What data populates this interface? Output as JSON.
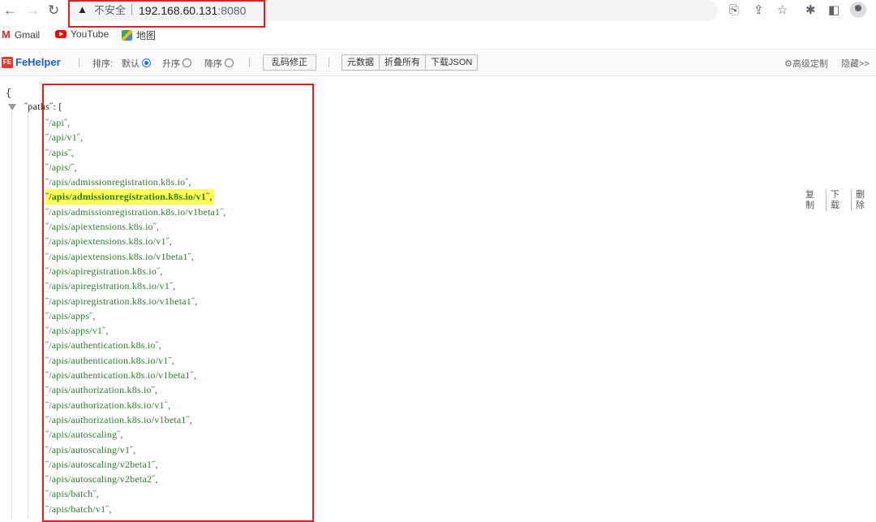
{
  "browser": {
    "warning_label": "不安全",
    "url_host": "192.168.60.131",
    "url_port": ":8080"
  },
  "bookmarks": [
    {
      "label": "Gmail"
    },
    {
      "label": "YouTube"
    },
    {
      "label": "地图"
    }
  ],
  "fehelper": {
    "logo": "FeHelper",
    "sort_label": "排序:",
    "sort_default": "默认",
    "sort_asc": "升序",
    "sort_desc": "降序",
    "fix_encoding": "乱码修正",
    "raw_data": "元数据",
    "collapse_all": "折叠所有",
    "download_json": "下载JSON",
    "advanced": "高级定制",
    "hide": "隐藏>>"
  },
  "json": {
    "open_brace": "{",
    "key_text": "˝paths˝:  [",
    "paths": [
      "˝/api˝,",
      "˝/api/v1˝,",
      "˝/apis˝,",
      "˝/apis/˝,",
      "˝/apis/admissionregistration.k8s.io˝,",
      "˝/apis/admissionregistration.k8s.io/v1˝,",
      "˝/apis/admissionregistration.k8s.io/v1beta1˝,",
      "˝/apis/apiextensions.k8s.io˝,",
      "˝/apis/apiextensions.k8s.io/v1˝,",
      "˝/apis/apiextensions.k8s.io/v1beta1˝,",
      "˝/apis/apiregistration.k8s.io˝,",
      "˝/apis/apiregistration.k8s.io/v1˝,",
      "˝/apis/apiregistration.k8s.io/v1beta1˝,",
      "˝/apis/apps˝,",
      "˝/apis/apps/v1˝,",
      "˝/apis/authentication.k8s.io˝,",
      "˝/apis/authentication.k8s.io/v1˝,",
      "˝/apis/authentication.k8s.io/v1beta1˝,",
      "˝/apis/authorization.k8s.io˝,",
      "˝/apis/authorization.k8s.io/v1˝,",
      "˝/apis/authorization.k8s.io/v1beta1˝,",
      "˝/apis/autoscaling˝,",
      "˝/apis/autoscaling/v1˝,",
      "˝/apis/autoscaling/v2beta1˝,",
      "˝/apis/autoscaling/v2beta2˝,",
      "˝/apis/batch˝,",
      "˝/apis/batch/v1˝,"
    ],
    "highlighted_index": 5
  },
  "side_tools": [
    "复制",
    "下载",
    "删除"
  ]
}
